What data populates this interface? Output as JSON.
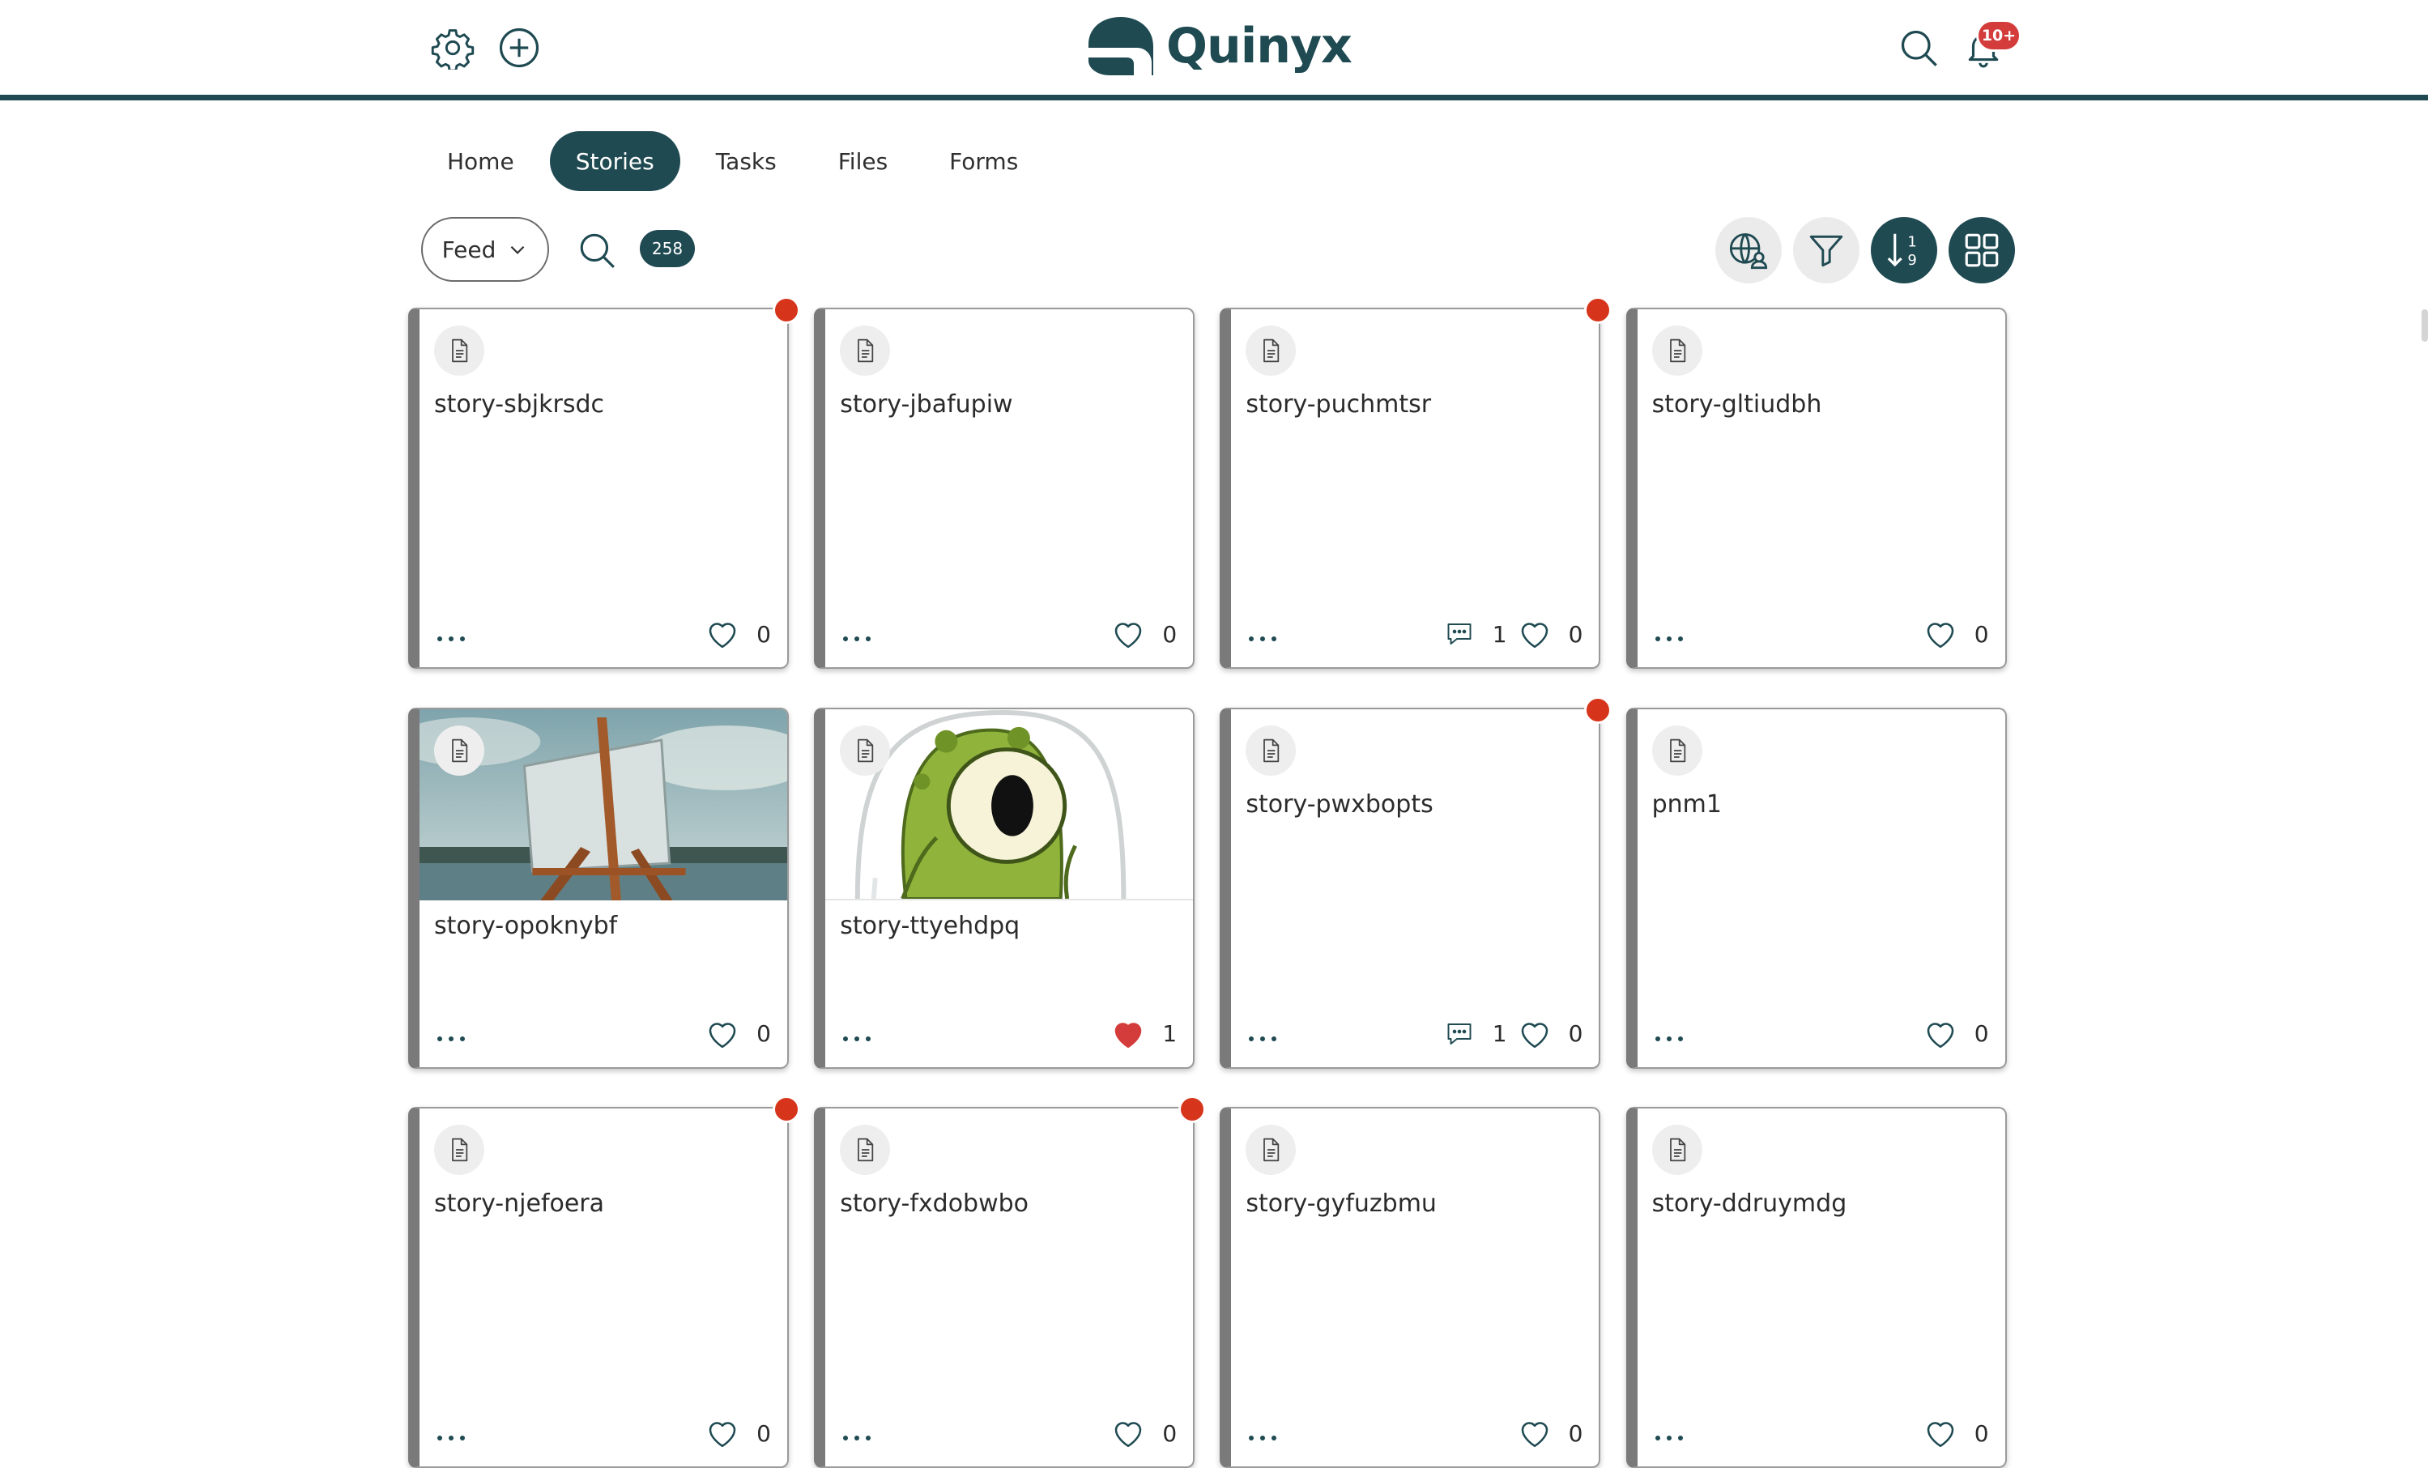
{
  "header": {
    "brand": "Quinyx",
    "notification_badge": "10+",
    "brand_color": "#1f4a52",
    "icons": [
      "gear-icon",
      "plus-circle-icon",
      "search-icon",
      "bell-icon"
    ]
  },
  "tabs": [
    {
      "label": "Home",
      "active": false
    },
    {
      "label": "Stories",
      "active": true
    },
    {
      "label": "Tasks",
      "active": false
    },
    {
      "label": "Files",
      "active": false
    },
    {
      "label": "Forms",
      "active": false
    }
  ],
  "toolbar": {
    "feed_label": "Feed",
    "count": "258",
    "icons": [
      "globe-user-icon",
      "filter-icon",
      "sort-numeric-icon",
      "grid-view-icon"
    ]
  },
  "cards": [
    {
      "title": "story-sbjkrsdc",
      "likes": "0",
      "comments": null,
      "liked": false,
      "unread": true,
      "media": null
    },
    {
      "title": "story-jbafupiw",
      "likes": "0",
      "comments": null,
      "liked": false,
      "unread": false,
      "media": null
    },
    {
      "title": "story-puchmtsr",
      "likes": "0",
      "comments": "1",
      "liked": false,
      "unread": true,
      "media": null
    },
    {
      "title": "story-gltiudbh",
      "likes": "0",
      "comments": null,
      "liked": false,
      "unread": false,
      "media": null
    },
    {
      "title": "story-opoknybf",
      "likes": "0",
      "comments": null,
      "liked": false,
      "unread": false,
      "media": "easel-landscape"
    },
    {
      "title": "story-ttyehdpq",
      "likes": "1",
      "comments": null,
      "liked": true,
      "unread": false,
      "media": "green-alien"
    },
    {
      "title": "story-pwxbopts",
      "likes": "0",
      "comments": "1",
      "liked": false,
      "unread": true,
      "media": null
    },
    {
      "title": "pnm1",
      "likes": "0",
      "comments": null,
      "liked": false,
      "unread": false,
      "media": null
    },
    {
      "title": "story-njefoera",
      "likes": "0",
      "comments": null,
      "liked": false,
      "unread": true,
      "media": null
    },
    {
      "title": "story-fxdobwbo",
      "likes": "0",
      "comments": null,
      "liked": false,
      "unread": true,
      "media": null
    },
    {
      "title": "story-gyfuzbmu",
      "likes": "0",
      "comments": null,
      "liked": false,
      "unread": false,
      "media": null
    },
    {
      "title": "story-ddruymdg",
      "likes": "0",
      "comments": null,
      "liked": false,
      "unread": false,
      "media": null
    }
  ],
  "colors": {
    "accent": "#1f4a52",
    "unread_dot": "#d6351c",
    "liked_heart": "#d43b3b"
  }
}
